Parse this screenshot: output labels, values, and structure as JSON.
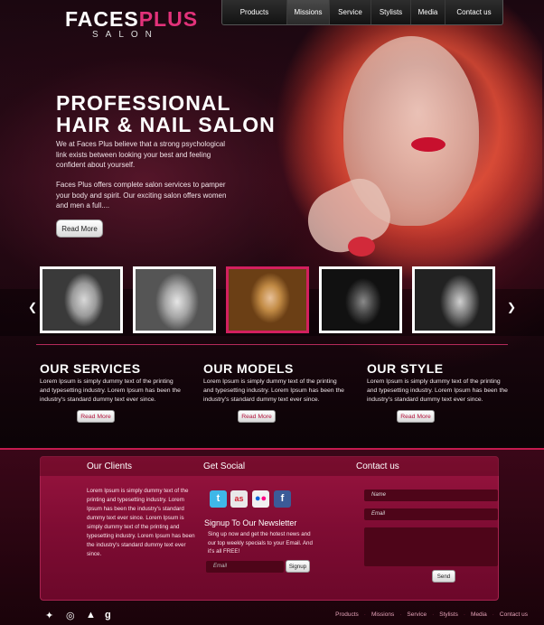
{
  "logo": {
    "faces": "FACES",
    "plus": "PLUS",
    "sub": "SALON"
  },
  "nav": [
    "Products",
    "Missions",
    "Service",
    "Stylists",
    "Media",
    "Contact us"
  ],
  "hero": {
    "title_line1": "PROFESSIONAL",
    "title_line2": "HAIR & NAIL SALON",
    "p1": "We at Faces Plus believe that a strong psychological link exists between looking your best and feeling confident about yourself.",
    "p2": "Faces Plus offers complete salon services to pamper your body and spirit. Our exciting salon offers women and men a full....",
    "button": "Read More"
  },
  "carousel": {
    "prev_icon": "chevron-left-icon",
    "next_icon": "chevron-right-icon",
    "active_index": 2
  },
  "sections": [
    {
      "title": "OUR SERVICES",
      "text": "Lorem Ipsum is simply dummy text of the printing and typesetting industry. Lorem Ipsum has been the industry's standard dummy text ever since.",
      "button": "Read More"
    },
    {
      "title": "OUR MODELS",
      "text": "Lorem Ipsum is simply dummy text of the printing and typesetting industry. Lorem Ipsum has been the industry's standard dummy text ever since.",
      "button": "Read More"
    },
    {
      "title": "OUR STYLE",
      "text": "Lorem Ipsum is simply dummy text of the printing and typesetting industry. Lorem Ipsum has been the industry's standard dummy text ever since.",
      "button": "Read More"
    }
  ],
  "clients": {
    "title": "Our Clients",
    "text": "Lorem Ipsum is simply dummy text of the printing and typesetting industry. Lorem Ipsum has been the industry's standard dummy text ever since. Lorem Ipsum is simply dummy text of the printing and typesetting industry. Lorem Ipsum has been the industry's standard dummy text ever since."
  },
  "social": {
    "title": "Get Social",
    "icons": [
      "twitter-icon",
      "lastfm-icon",
      "flickr-icon",
      "facebook-icon"
    ],
    "newsletter_title": "Signup To Our Newsletter",
    "newsletter_text": "Sing up now and get the hotest news and our top weekly specials to your Email. And it's all FREE!",
    "email_placeholder": "Email",
    "signup_button": "Signup"
  },
  "contact": {
    "title": "Contact us",
    "name_placeholder": "Name",
    "email_placeholder": "Email",
    "send_button": "Send"
  },
  "footer": {
    "icons": [
      "twitter-icon",
      "dribbble-icon",
      "delicious-icon",
      "google-plus-icon"
    ],
    "links": [
      "Products",
      "Missions",
      "Service",
      "Stylists",
      "Media",
      "Contact us"
    ]
  },
  "colors": {
    "accent": "#d3205f",
    "panel": "#8e1039",
    "background": "#0a0306"
  }
}
